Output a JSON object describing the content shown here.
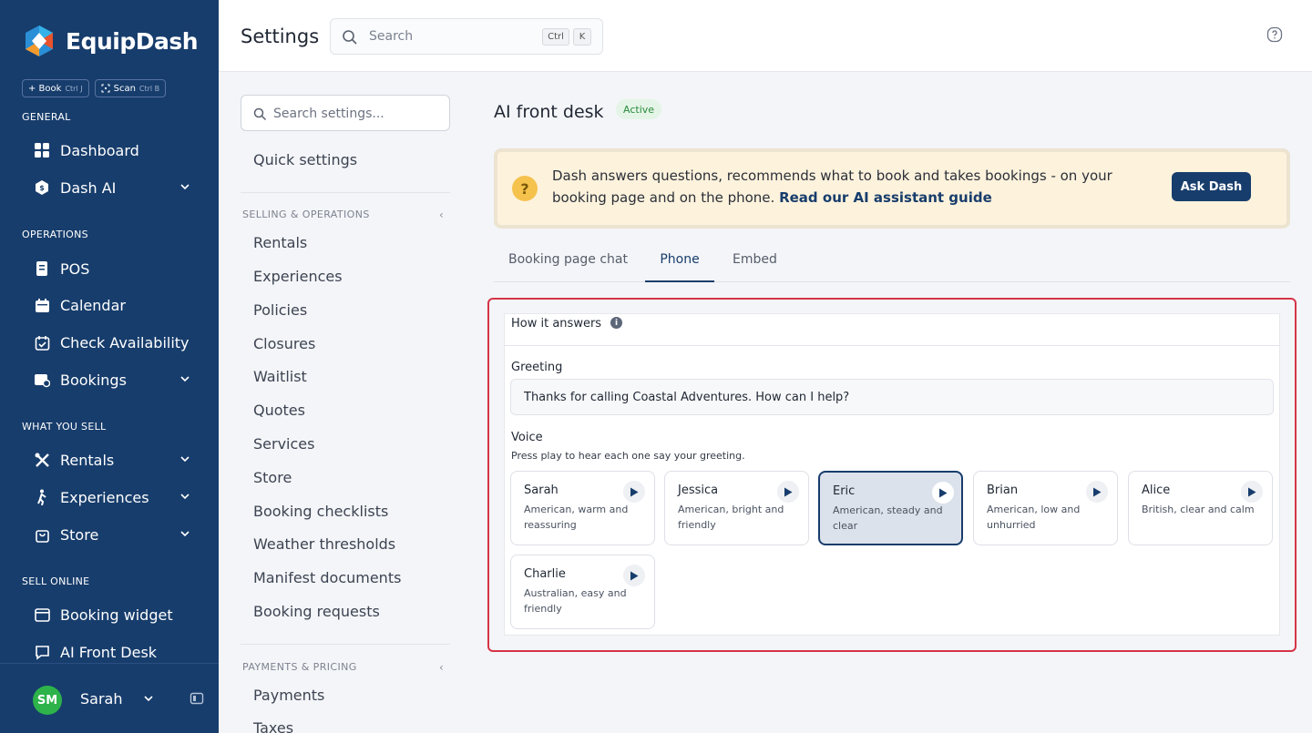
{
  "brand": {
    "name": "EquipDash"
  },
  "quick_actions": [
    {
      "label": "+ Book",
      "shortcut": "Ctrl J"
    },
    {
      "label": "Scan",
      "shortcut": "Ctrl B"
    }
  ],
  "sidebar": {
    "sections": [
      {
        "label": "GENERAL"
      },
      {
        "label": "OPERATIONS"
      },
      {
        "label": "WHAT YOU SELL"
      },
      {
        "label": "SELL ONLINE"
      }
    ],
    "items": [
      {
        "label": "Dashboard",
        "icon": "grid-icon"
      },
      {
        "label": "Dash AI",
        "icon": "hexagon-icon",
        "expandable": true
      },
      {
        "label": "POS",
        "icon": "receipt-icon"
      },
      {
        "label": "Calendar",
        "icon": "calendar-icon"
      },
      {
        "label": "Check Availability",
        "icon": "calendar-check-icon"
      },
      {
        "label": "Bookings",
        "icon": "bookings-icon",
        "expandable": true
      },
      {
        "label": "Rentals",
        "icon": "tools-icon",
        "expandable": true
      },
      {
        "label": "Experiences",
        "icon": "hiker-icon",
        "expandable": true
      },
      {
        "label": "Store",
        "icon": "shopping-bag-icon",
        "expandable": true
      },
      {
        "label": "Booking widget",
        "icon": "widget-icon"
      },
      {
        "label": "AI Front Desk",
        "icon": "chat-bubble-icon"
      }
    ],
    "user": {
      "initials": "SM",
      "name": "Sarah",
      "avatar_color": "#2db34a"
    }
  },
  "header": {
    "title": "Settings",
    "search_placeholder": "Search",
    "shortcut_keys": [
      "Ctrl",
      "K"
    ]
  },
  "settings_nav": {
    "search_placeholder": "Search settings...",
    "quick_settings": "Quick settings",
    "sections": [
      {
        "label": "SELLING & OPERATIONS"
      },
      {
        "label": "PAYMENTS & PRICING"
      }
    ],
    "selling_items": [
      "Rentals",
      "Experiences",
      "Policies",
      "Closures",
      "Waitlist",
      "Quotes",
      "Services",
      "Store",
      "Booking checklists",
      "Weather thresholds",
      "Manifest documents",
      "Booking requests"
    ],
    "payment_items": [
      "Payments",
      "Taxes"
    ]
  },
  "main": {
    "title": "AI front desk",
    "status_badge": "Active",
    "banner": {
      "text": "Dash answers questions, recommends what to book and takes bookings - on your booking page and on the phone.",
      "link": "Read our AI assistant guide",
      "button": "Ask Dash"
    },
    "tabs": [
      "Booking page chat",
      "Phone",
      "Embed"
    ],
    "active_tab": "Phone",
    "panel": {
      "title": "How it answers",
      "greeting_label": "Greeting",
      "greeting_value": "Thanks for calling Coastal Adventures. How can I help?",
      "voice_label": "Voice",
      "voice_hint": "Press play to hear each one say your greeting.",
      "voices": [
        {
          "name": "Sarah",
          "desc": "American, warm and reassuring",
          "selected": false
        },
        {
          "name": "Jessica",
          "desc": "American, bright and friendly",
          "selected": false
        },
        {
          "name": "Eric",
          "desc": "American, steady and clear",
          "selected": true
        },
        {
          "name": "Brian",
          "desc": "American, low and unhurried",
          "selected": false
        },
        {
          "name": "Alice",
          "desc": "British, clear and calm",
          "selected": false
        },
        {
          "name": "Charlie",
          "desc": "Australian, easy and friendly",
          "selected": false
        }
      ]
    }
  },
  "colors": {
    "sidebar": "#173d6c",
    "accent": "#173d6c",
    "highlight_border": "#d63447",
    "banner": "#fdf2dc"
  }
}
